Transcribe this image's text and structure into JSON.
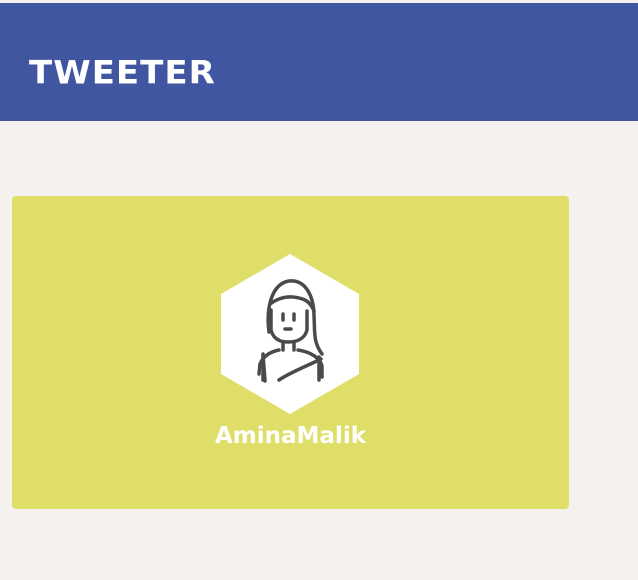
{
  "header": {
    "logo_text": "TWEETER"
  },
  "profile_card": {
    "username": "AminaMalik",
    "avatar_icon": "woman-avatar-icon"
  },
  "colors": {
    "header_bg": "#4056a1",
    "page_bg": "#f4f1ee",
    "card_bg": "#dede69",
    "text_on_color": "#ffffff"
  }
}
